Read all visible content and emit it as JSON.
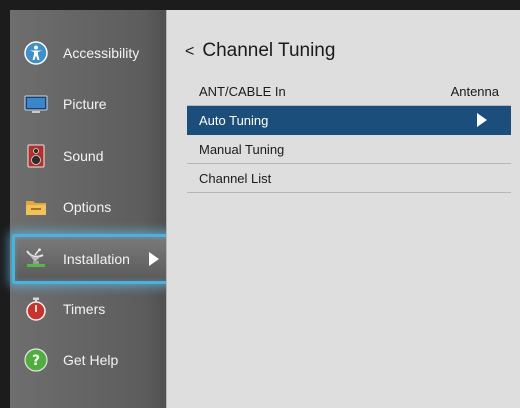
{
  "sidebar": {
    "items": [
      {
        "label": "Accessibility",
        "icon": "accessibility-icon"
      },
      {
        "label": "Picture",
        "icon": "monitor-icon"
      },
      {
        "label": "Sound",
        "icon": "speaker-icon"
      },
      {
        "label": "Options",
        "icon": "folder-icon"
      },
      {
        "label": "Installation",
        "icon": "satellite-dish-icon",
        "selected": true
      },
      {
        "label": "Timers",
        "icon": "stopwatch-icon"
      },
      {
        "label": "Get Help",
        "icon": "help-icon"
      }
    ]
  },
  "main": {
    "back_symbol": "<",
    "title": "Channel Tuning",
    "rows": [
      {
        "label": "ANT/CABLE In",
        "value": "Antenna"
      },
      {
        "label": "Auto Tuning",
        "selected": true
      },
      {
        "label": "Manual Tuning"
      },
      {
        "label": "Channel List"
      }
    ]
  },
  "colors": {
    "sidebar_bg": "#5f5f5f",
    "content_bg": "#dedede",
    "selection_blue": "#1b4e7a",
    "focus_glow": "#49b2dd"
  }
}
